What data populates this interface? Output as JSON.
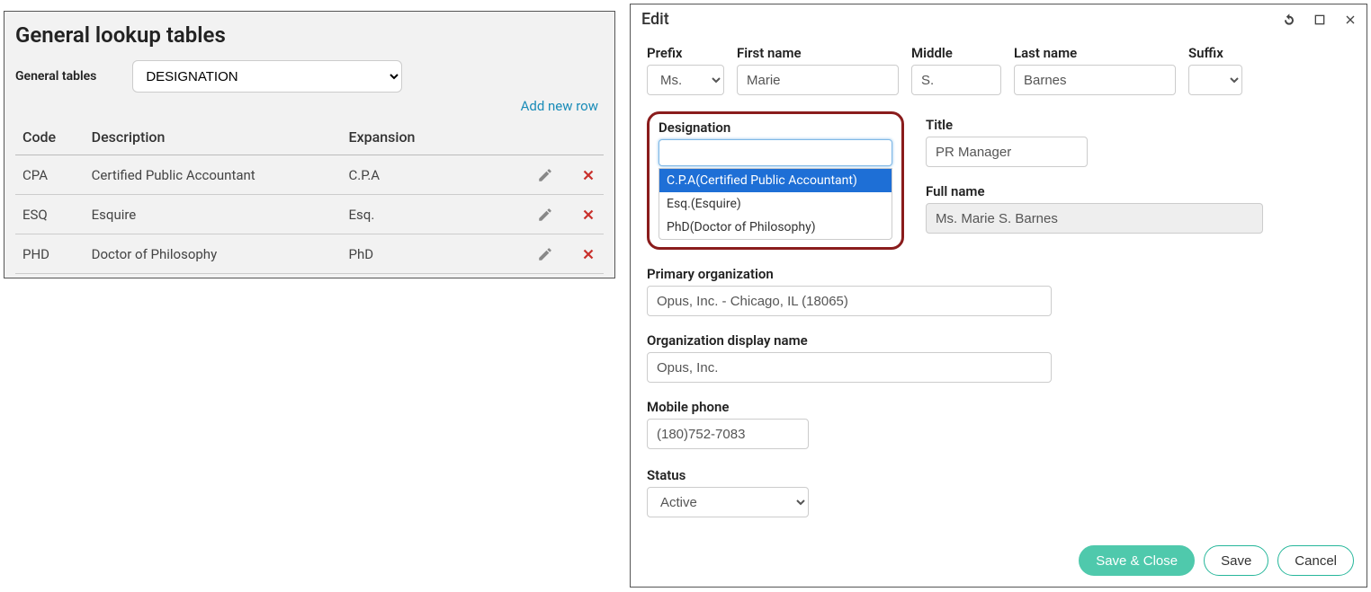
{
  "left": {
    "title": "General lookup tables",
    "tables_label": "General tables",
    "tables_selected": "DESIGNATION",
    "add_row": "Add new row",
    "cols": {
      "code": "Code",
      "desc": "Description",
      "exp": "Expansion"
    },
    "rows": [
      {
        "code": "CPA",
        "desc": "Certified Public Accountant",
        "exp": "C.P.A"
      },
      {
        "code": "ESQ",
        "desc": "Esquire",
        "exp": "Esq."
      },
      {
        "code": "PHD",
        "desc": "Doctor of Philosophy",
        "exp": "PhD"
      }
    ]
  },
  "right": {
    "title": "Edit",
    "labels": {
      "prefix": "Prefix",
      "first": "First name",
      "middle": "Middle",
      "last": "Last name",
      "suffix": "Suffix",
      "designation": "Designation",
      "titlef": "Title",
      "full": "Full name",
      "primary_org": "Primary organization",
      "org_display": "Organization display name",
      "mobile": "Mobile phone",
      "status": "Status"
    },
    "values": {
      "prefix": "Ms.",
      "first": "Marie",
      "middle": "S.",
      "last": "Barnes",
      "suffix": "",
      "designation": "",
      "titlef": "PR Manager",
      "full": "Ms. Marie S. Barnes",
      "primary_org": "Opus, Inc. - Chicago, IL (18065)",
      "org_display": "Opus, Inc.",
      "mobile": "(180)752-7083",
      "status": "Active"
    },
    "designation_options": [
      "C.P.A(Certified Public Accountant)",
      "Esq.(Esquire)",
      "PhD(Doctor of Philosophy)"
    ],
    "buttons": {
      "save_close": "Save & Close",
      "save": "Save",
      "cancel": "Cancel"
    }
  }
}
